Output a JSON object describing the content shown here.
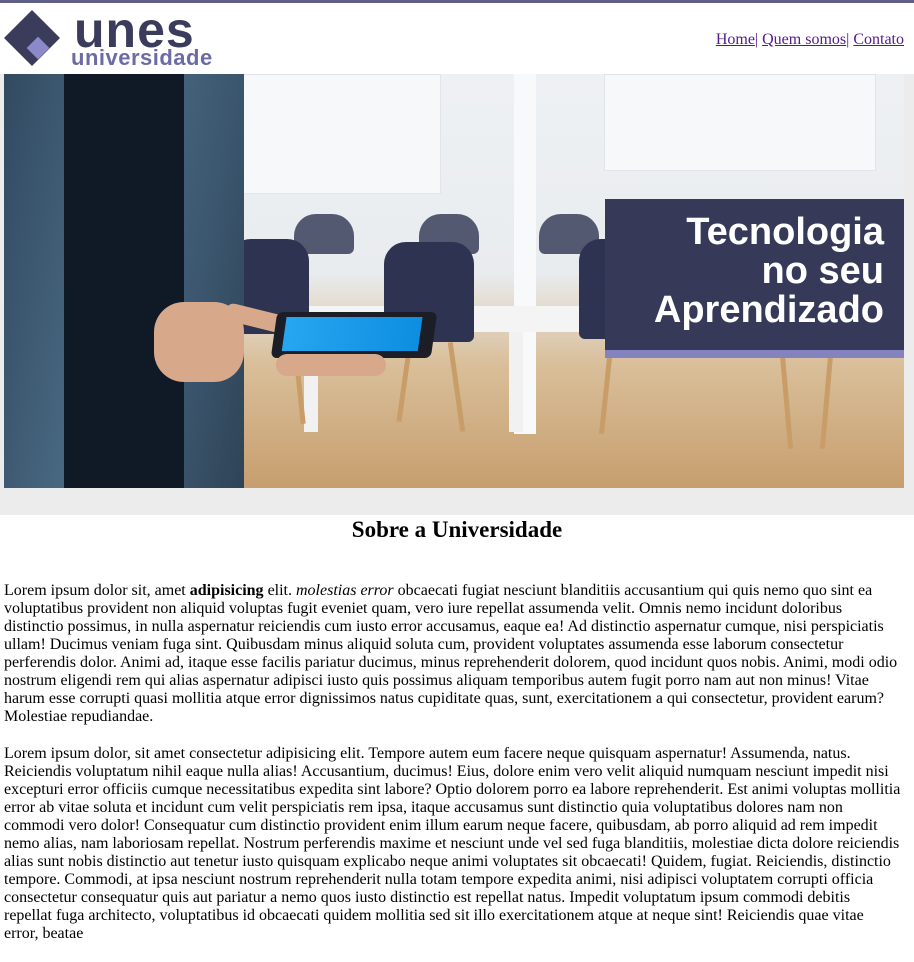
{
  "header": {
    "logo_word1": "unes",
    "logo_word2": "universidade",
    "nav": [
      "Home",
      "Quem somos",
      "Contato"
    ],
    "nav_separator": "|"
  },
  "hero": {
    "banner_lines": [
      "Tecnologia",
      "no seu",
      "Aprendizado"
    ]
  },
  "main": {
    "title": "Sobre a Universidade",
    "paragraph1": {
      "part1": "Lorem ipsum dolor sit, amet ",
      "bold": "adipisicing",
      "part2": " elit. ",
      "italic": "molestias error",
      "part3": " obcaecati fugiat nesciunt blanditiis accusantium qui quis nemo quo sint ea voluptatibus provident non aliquid voluptas fugit eveniet quam, vero iure repellat assumenda velit. Omnis nemo incidunt doloribus distinctio possimus, in nulla aspernatur reiciendis cum iusto error accusamus, eaque ea! Ad distinctio aspernatur cumque, nisi perspiciatis ullam! Ducimus veniam fuga sint. Quibusdam minus aliquid soluta cum, provident voluptates assumenda esse laborum consectetur perferendis dolor. Animi ad, itaque esse facilis pariatur ducimus, minus reprehenderit dolorem, quod incidunt quos nobis. Animi, modi odio nostrum eligendi rem qui alias aspernatur adipisci iusto quis possimus aliquam temporibus autem fugit porro nam aut non minus! Vitae harum esse corrupti quasi mollitia atque error dignissimos natus cupiditate quas, sunt, exercitationem a qui consectetur, provident earum? Molestiae repudiandae."
    },
    "paragraph2": "Lorem ipsum dolor, sit amet consectetur adipisicing elit. Tempore autem eum facere neque quisquam aspernatur! Assumenda, natus. Reiciendis voluptatum nihil eaque nulla alias! Accusantium, ducimus! Eius, dolore enim vero velit aliquid numquam nesciunt impedit nisi excepturi error officiis cumque necessitatibus expedita sint labore? Optio dolorem porro ea labore reprehenderit. Est animi voluptas mollitia error ab vitae soluta et incidunt cum velit perspiciatis rem ipsa, itaque accusamus sunt distinctio quia voluptatibus dolores nam non commodi vero dolor! Consequatur cum distinctio provident enim illum earum neque facere, quibusdam, ab porro aliquid ad rem impedit nemo alias, nam laboriosam repellat. Nostrum perferendis maxime et nesciunt unde vel sed fuga blanditiis, molestiae dicta dolore reiciendis alias sunt nobis distinctio aut tenetur iusto quisquam explicabo neque animi voluptates sit obcaecati! Quidem, fugiat. Reiciendis, distinctio tempore. Commodi, at ipsa nesciunt nostrum reprehenderit nulla totam tempore expedita animi, nisi adipisci voluptatem corrupti officia consectetur consequatur quis aut pariatur a nemo quos iusto distinctio est repellat natus. Impedit voluptatum ipsum commodi debitis repellat fuga architecto, voluptatibus id obcaecati quidem mollitia sed sit illo exercitationem atque at neque sint! Reiciendis quae vitae error, beatae"
  }
}
